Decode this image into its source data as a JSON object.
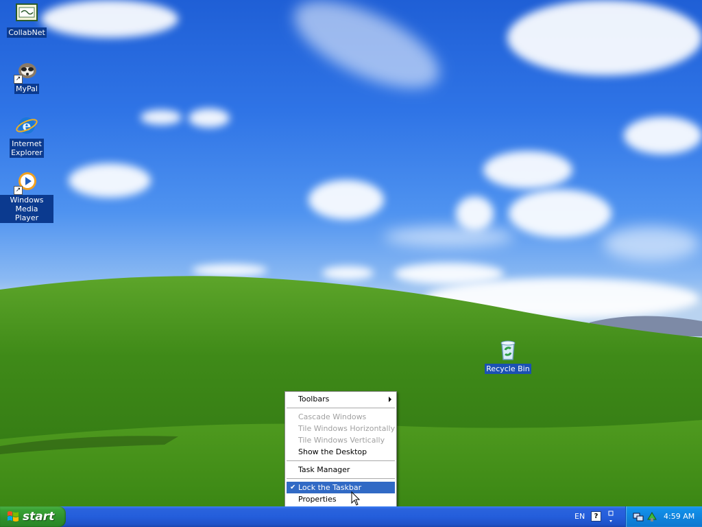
{
  "desktop": {
    "icons": [
      {
        "label": "CollabNet",
        "icon": "collabnet-icon"
      },
      {
        "label": "MyPal",
        "icon": "mypal-icon"
      },
      {
        "label_line1": "Internet",
        "label_line2": "Explorer",
        "icon": "internet-explorer-icon"
      },
      {
        "label_line1": "Windows Media",
        "label_line2": "Player",
        "icon": "windows-media-player-icon"
      },
      {
        "label": "Recycle Bin",
        "icon": "recycle-bin-icon"
      }
    ]
  },
  "context_menu": {
    "items": [
      {
        "label": "Toolbars",
        "submenu": true
      },
      {
        "label": "Cascade Windows",
        "disabled": true
      },
      {
        "label": "Tile Windows Horizontally",
        "disabled": true
      },
      {
        "label": "Tile Windows Vertically",
        "disabled": true
      },
      {
        "label": "Show the Desktop"
      },
      {
        "label": "Task Manager"
      },
      {
        "label": "Lock the Taskbar",
        "checked": true,
        "highlighted": true
      },
      {
        "label": "Properties"
      }
    ]
  },
  "taskbar": {
    "start_label": "start",
    "language": "EN",
    "help_symbol": "?",
    "clock": "4:59 AM"
  },
  "colors": {
    "taskbar_blue": "#245edb",
    "start_green": "#3aa335",
    "tray_blue": "#0f83dc",
    "menu_highlight": "#316ac5"
  }
}
